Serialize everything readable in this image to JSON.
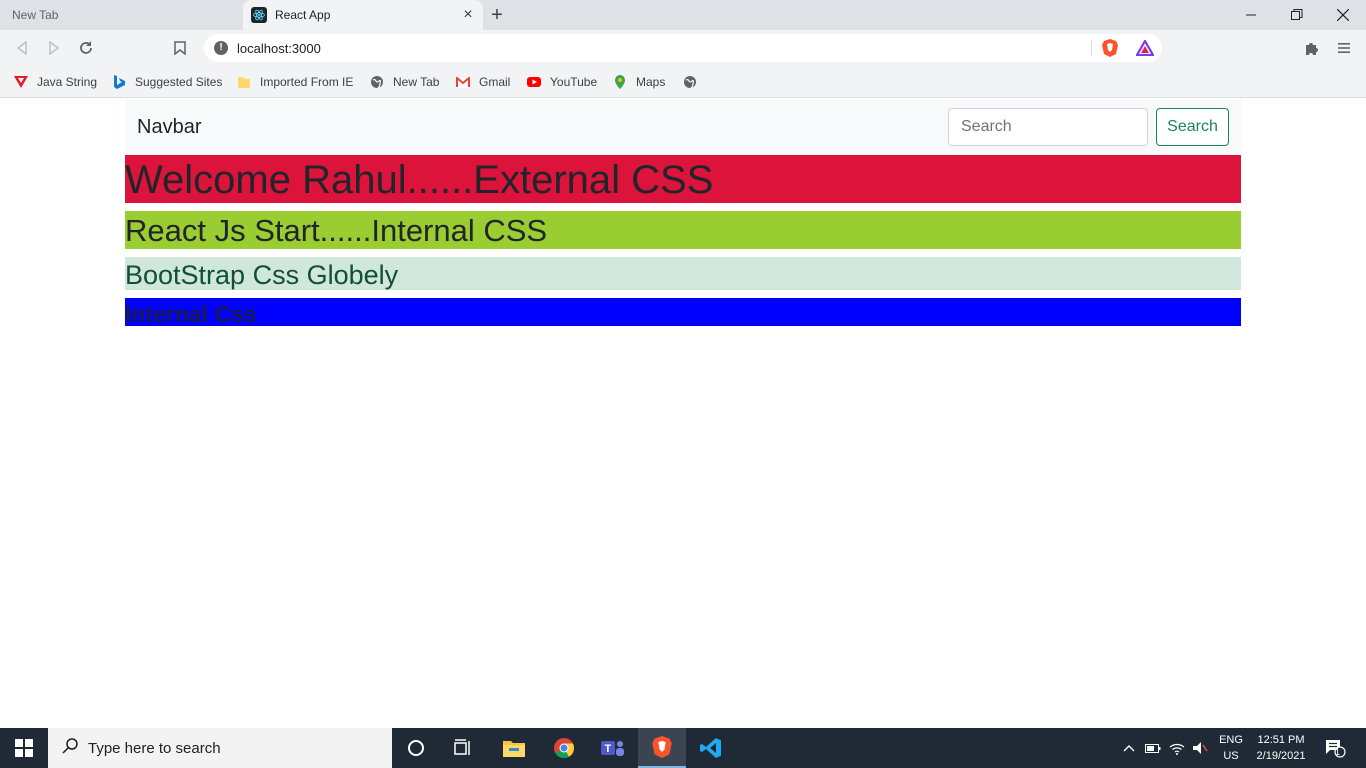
{
  "browser": {
    "tabs": [
      {
        "title": "New Tab",
        "active": false
      },
      {
        "title": "React App",
        "active": true
      }
    ],
    "url": "localhost:3000",
    "bookmarks": [
      {
        "label": "Java String",
        "icon": "red-v-icon"
      },
      {
        "label": "Suggested Sites",
        "icon": "bing-icon"
      },
      {
        "label": "Imported From IE",
        "icon": "folder-icon"
      },
      {
        "label": "New Tab",
        "icon": "globe-icon"
      },
      {
        "label": "Gmail",
        "icon": "gmail-icon"
      },
      {
        "label": "YouTube",
        "icon": "youtube-icon"
      },
      {
        "label": "Maps",
        "icon": "maps-icon"
      },
      {
        "label": "",
        "icon": "globe-icon"
      }
    ]
  },
  "page": {
    "navbar": {
      "brand": "Navbar",
      "search_placeholder": "Search",
      "search_button": "Search"
    },
    "headings": {
      "external": "Welcome Rahul......External CSS",
      "internal": "React Js Start......Internal CSS",
      "bootstrap": "BootStrap Css Globely",
      "blue": "Internal Css"
    },
    "colors": {
      "external_bg": "#dc143c",
      "internal_bg": "#9acd32",
      "bootstrap_bg": "#d1e7dd",
      "blue_bg": "#0000ff",
      "search_button": "#198754"
    }
  },
  "taskbar": {
    "search_placeholder": "Type here to search",
    "language": "ENG",
    "region": "US",
    "time": "12:51 PM",
    "date": "2/19/2021",
    "notification_count": "1"
  }
}
